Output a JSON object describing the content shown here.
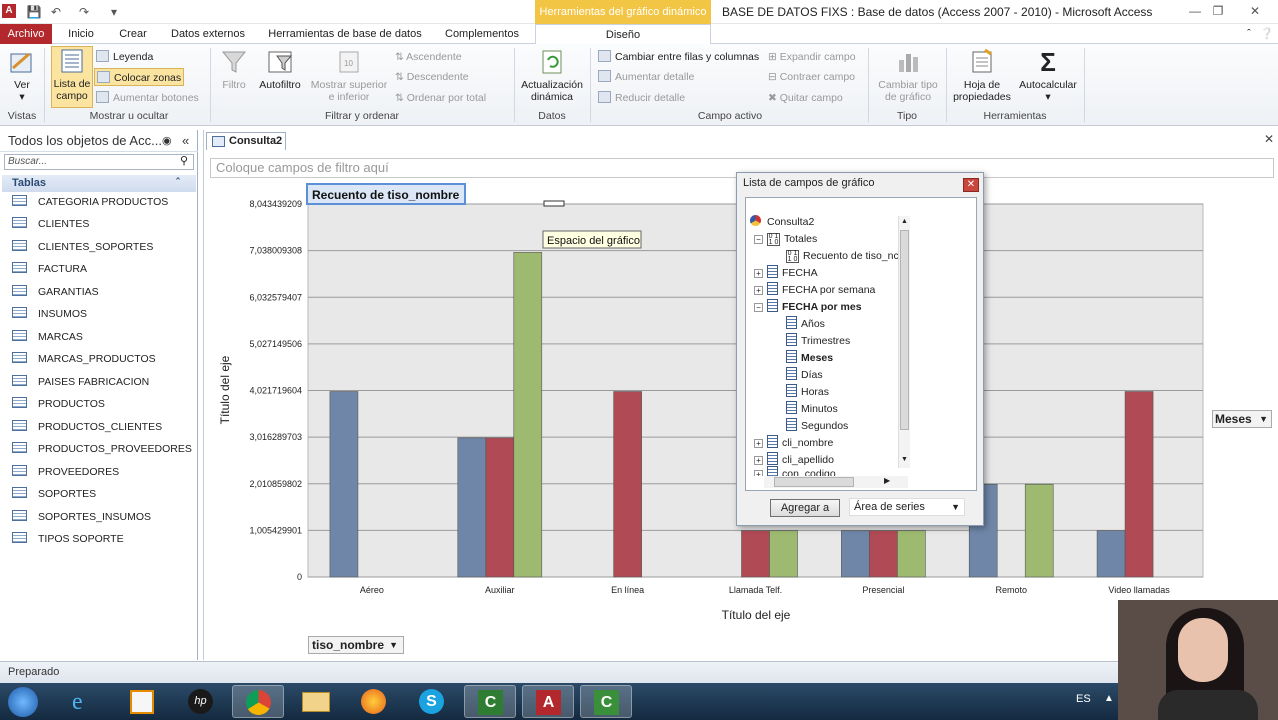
{
  "title_bar": {
    "app_icon": "A",
    "context_tab": "Herramientas del gráfico dinámico",
    "window_title": "BASE DE DATOS FIXS : Base de datos (Access 2007 - 2010)  -  Microsoft Access"
  },
  "tabs": [
    "Archivo",
    "Inicio",
    "Crear",
    "Datos externos",
    "Herramientas de base de datos",
    "Complementos",
    "Diseño"
  ],
  "ribbon": {
    "ver": "Ver",
    "lista_de_campo": [
      "Lista de",
      "campo"
    ],
    "leyenda": "Leyenda",
    "colocar_zonas": "Colocar zonas",
    "aumentar_botones": "Aumentar botones",
    "filtro": "Filtro",
    "autofiltro": "Autofiltro",
    "mostrar_superior": [
      "Mostrar superior",
      "e inferior"
    ],
    "ascendente": "Ascendente",
    "descendente": "Descendente",
    "ordenar_por_total": "Ordenar por total",
    "actualizacion": [
      "Actualización",
      "dinámica"
    ],
    "cambiar_filas": "Cambiar entre filas y columnas",
    "aumentar_detalle": "Aumentar detalle",
    "reducir_detalle": "Reducir detalle",
    "expandir_campo": "Expandir campo",
    "contraer_campo": "Contraer campo",
    "quitar_campo": "Quitar campo",
    "cambiar_tipo": [
      "Cambiar tipo",
      "de gráfico"
    ],
    "hoja_propiedades": [
      "Hoja de",
      "propiedades"
    ],
    "autocalcular": "Autocalcular",
    "groups": [
      "Vistas",
      "Mostrar u ocultar",
      "Filtrar y ordenar",
      "Datos",
      "Campo activo",
      "Tipo",
      "Herramientas"
    ]
  },
  "nav": {
    "header": "Todos los objetos de Acc...",
    "search_placeholder": "Buscar...",
    "section": "Tablas",
    "items": [
      "CATEGORIA PRODUCTOS",
      "CLIENTES",
      "CLIENTES_SOPORTES",
      "FACTURA",
      "GARANTIAS",
      "INSUMOS",
      "MARCAS",
      "MARCAS_PRODUCTOS",
      "PAISES FABRICACION",
      "PRODUCTOS",
      "PRODUCTOS_CLIENTES",
      "PRODUCTOS_PROVEEDORES",
      "PROVEEDORES",
      "SOPORTES",
      "SOPORTES_INSUMOS",
      "TIPOS SOPORTE"
    ]
  },
  "document": {
    "tab": "Consulta2",
    "filter_zone": "Coloque campos de filtro aquí",
    "series_button": "Meses",
    "category_button": "tiso_nombre"
  },
  "chart_data": {
    "type": "bar",
    "title": "Recuento de tiso_nombre",
    "tooltip": "Espacio del gráfico",
    "xlabel": "Título del eje",
    "ylabel": "Título del eje",
    "ylim": [
      0,
      8.043439209
    ],
    "yticks": [
      "8,043439209",
      "7,038009308",
      "6,032579407",
      "5,027149506",
      "4,021719604",
      "3,016289703",
      "2,010859802",
      "1,005429901",
      "0"
    ],
    "categories": [
      "Aéreo",
      "Auxiliar",
      "En línea",
      "Llamada Telf.",
      "Presencial",
      "Remoto",
      "Video llamadas"
    ],
    "series": [
      {
        "color": "#6f86a8",
        "values": [
          4,
          3,
          null,
          null,
          1,
          2,
          1
        ]
      },
      {
        "color": "#b04a55",
        "values": [
          null,
          3,
          4,
          1,
          1,
          null,
          4
        ]
      },
      {
        "color": "#9dba70",
        "values": [
          null,
          7,
          null,
          1,
          1,
          2,
          null
        ]
      }
    ],
    "grid": true
  },
  "field_list": {
    "title": "Lista de campos de gráfico",
    "nodes": [
      {
        "label": "Consulta2"
      },
      {
        "label": "Totales"
      },
      {
        "label": "Recuento de tiso_nc"
      },
      {
        "label": "FECHA"
      },
      {
        "label": "FECHA por semana"
      },
      {
        "label": "FECHA por mes"
      },
      {
        "label": "Años"
      },
      {
        "label": "Trimestres"
      },
      {
        "label": "Meses"
      },
      {
        "label": "Días"
      },
      {
        "label": "Horas"
      },
      {
        "label": "Minutos"
      },
      {
        "label": "Segundos"
      },
      {
        "label": "cli_nombre"
      },
      {
        "label": "cli_apellido"
      },
      {
        "label": "con_codigo"
      }
    ],
    "add_button": "Agregar a",
    "area_select": "Área de series"
  },
  "status": "Preparado",
  "taskbar": {
    "lang": "ES"
  }
}
